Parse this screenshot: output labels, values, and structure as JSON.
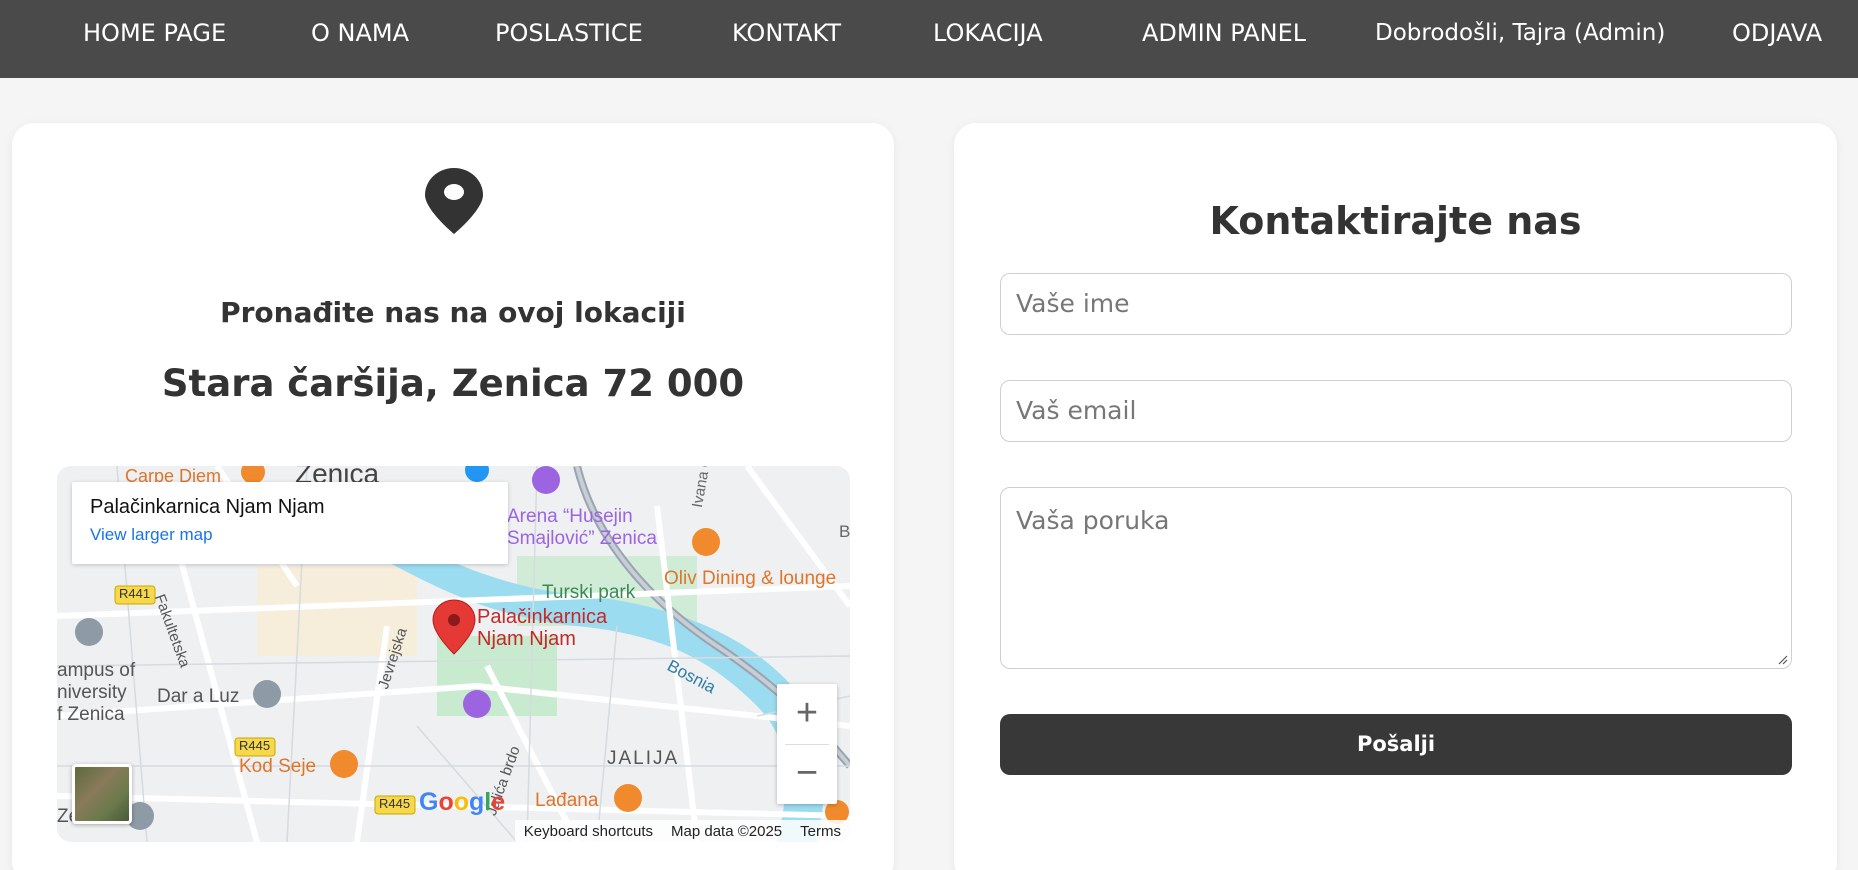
{
  "nav": {
    "items": [
      "HOME PAGE",
      "O NAMA",
      "POSLASTICE",
      "KONTAKT",
      "LOKACIJA",
      "ADMIN PANEL",
      "Dobrodošli, Tajra (Admin)",
      "ODJAVA"
    ]
  },
  "location": {
    "heading": "Pronađite nas na ovoj lokaciji",
    "address": "Stara čaršija, Zenica 72 000",
    "icon": "map-pin-icon"
  },
  "map": {
    "place_name": "Palačinkarnica Njam Njam",
    "view_larger": "View larger map",
    "marker_label_line1": "Palačinkarnica",
    "marker_label_line2": "Njam Njam",
    "labels": {
      "carpe_diem": "Carpe Diem",
      "zenica": "Zenica",
      "arena1": "Arena “Husejin",
      "arena2": "Smajlović” Zenica",
      "ivana": "Ivana G",
      "oliv": "Oliv Dining & lounge",
      "turski": "Turski park",
      "bosnia": "Bosnia",
      "fakultetska": "Fakultetska",
      "jevrejska": "Jevrejska",
      "campus1": "ampus of",
      "campus2": "niversity",
      "campus3": "f Zenica",
      "dar": "Dar a Luz",
      "jalija": "JALIJA",
      "kod_seje": "Kod Seje",
      "ladjana": "Lađana",
      "brdo": "Jalića brdo",
      "ze": "Ze",
      "b": "B",
      "r441": "R441",
      "r445a": "R445",
      "r445b": "R445"
    },
    "zoom_in": "+",
    "zoom_out": "−",
    "google": "Google",
    "footer": {
      "shortcuts": "Keyboard shortcuts",
      "data": "Map data ©2025",
      "terms": "Terms"
    }
  },
  "contact": {
    "title": "Kontaktirajte nas",
    "name_placeholder": "Vaše ime",
    "email_placeholder": "Vaš email",
    "message_placeholder": "Vaša poruka",
    "submit_label": "Pošalji"
  },
  "colors": {
    "nav_bg": "#4a4a4a",
    "button_bg": "#383838",
    "water": "#9cdcf0",
    "marker": "#e53935",
    "link": "#1a73e8",
    "poi_orange": "#f08a2c",
    "poi_purple": "#9c64e0"
  }
}
